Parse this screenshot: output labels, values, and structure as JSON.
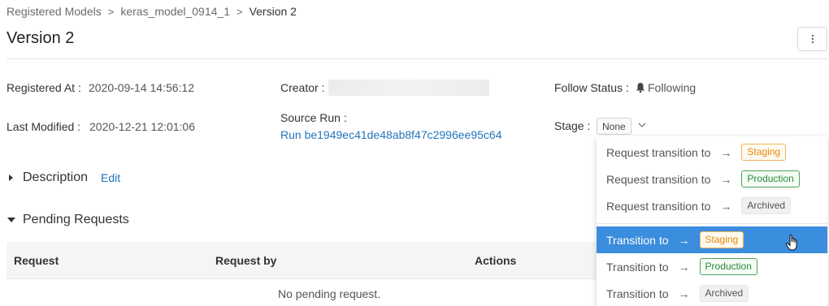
{
  "breadcrumb": {
    "items": [
      "Registered Models",
      "keras_model_0914_1"
    ],
    "separator": ">",
    "current": "Version 2"
  },
  "page": {
    "title": "Version 2",
    "menu_icon": "kebab-icon"
  },
  "metadata": {
    "registered_at": {
      "label": "Registered At",
      "value": "2020-09-14 14:56:12"
    },
    "last_modified": {
      "label": "Last Modified",
      "value": "2020-12-21 12:01:06"
    },
    "creator": {
      "label": "Creator"
    },
    "source_run": {
      "label": "Source Run",
      "value": "Run be1949ec41de48ab8f47c2996ee95c64"
    },
    "follow_status": {
      "label": "Follow Status",
      "value": "Following",
      "icon": "bell-icon"
    },
    "stage": {
      "label": "Stage",
      "value": "None"
    }
  },
  "sections": {
    "description": {
      "title": "Description",
      "edit_label": "Edit"
    },
    "pending": {
      "title": "Pending Requests"
    }
  },
  "pending_table": {
    "columns": [
      "Request",
      "Request by",
      "Actions"
    ],
    "empty_text": "No pending request."
  },
  "stage_dropdown": {
    "request_items": [
      {
        "label": "Request transition to",
        "stage": "Staging"
      },
      {
        "label": "Request transition to",
        "stage": "Production"
      },
      {
        "label": "Request transition to",
        "stage": "Archived"
      }
    ],
    "transition_items": [
      {
        "label": "Transition to",
        "stage": "Staging"
      },
      {
        "label": "Transition to",
        "stage": "Production"
      },
      {
        "label": "Transition to",
        "stage": "Archived"
      }
    ],
    "arrow": "→"
  },
  "colors": {
    "link": "#2374bb",
    "highlight": "#3b8ddd",
    "staging": "#e8890c",
    "production": "#2d8a3a",
    "archived": "#555555"
  }
}
